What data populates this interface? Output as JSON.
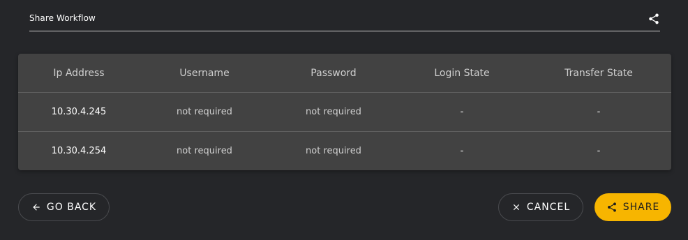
{
  "header": {
    "title": "Share Workflow",
    "icon": "share-icon"
  },
  "table": {
    "columns": [
      "Ip Address",
      "Username",
      "Password",
      "Login State",
      "Transfer State"
    ],
    "rows": [
      [
        "10.30.4.245",
        "not required",
        "not required",
        "-",
        "-"
      ],
      [
        "10.30.4.254",
        "not required",
        "not required",
        "-",
        "-"
      ]
    ]
  },
  "actions": {
    "back_label": "GO BACK",
    "back_icon": "arrow-left-icon",
    "cancel_label": "CANCEL",
    "cancel_icon": "close-icon",
    "share_label": "SHARE",
    "share_icon": "share-icon"
  },
  "colors": {
    "background": "#252629",
    "table_bg": "#424242",
    "accent": "#f7b500"
  }
}
